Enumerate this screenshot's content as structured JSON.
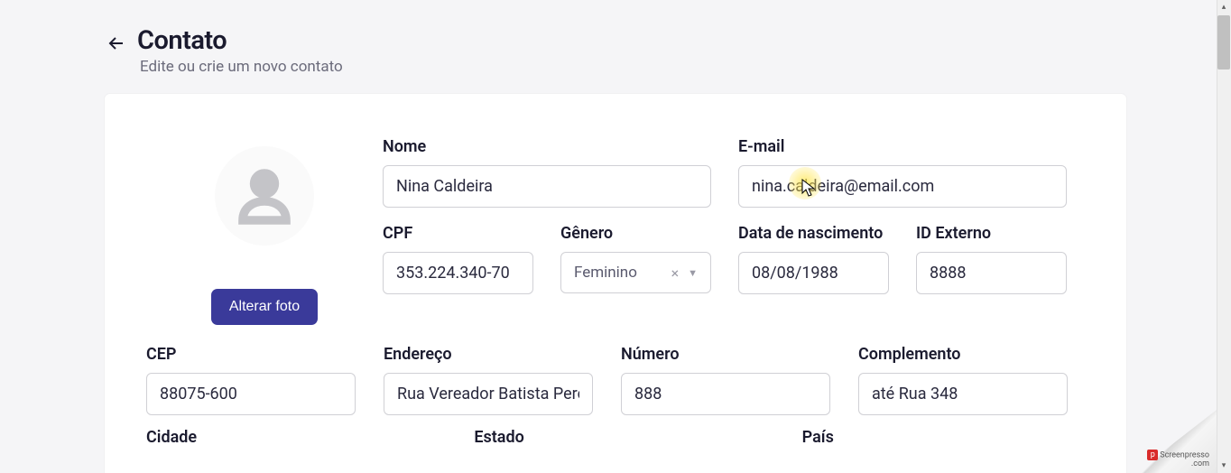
{
  "header": {
    "title": "Contato",
    "subtitle": "Edite ou crie um novo contato"
  },
  "avatar": {
    "change_photo_label": "Alterar foto"
  },
  "fields": {
    "nome": {
      "label": "Nome",
      "value": "Nina Caldeira"
    },
    "email": {
      "label": "E-mail",
      "value": "nina.caldeira@email.com"
    },
    "cpf": {
      "label": "CPF",
      "value": "353.224.340-70"
    },
    "genero": {
      "label": "Gênero",
      "value": "Feminino"
    },
    "data_nascimento": {
      "label": "Data de nascimento",
      "value": "08/08/1988"
    },
    "id_externo": {
      "label": "ID Externo",
      "value": "8888"
    },
    "cep": {
      "label": "CEP",
      "value": "88075-600"
    },
    "endereco": {
      "label": "Endereço",
      "value": "Rua Vereador Batista Pere"
    },
    "numero": {
      "label": "Número",
      "value": "888"
    },
    "complemento": {
      "label": "Complemento",
      "value": "até Rua 348"
    },
    "cidade": {
      "label": "Cidade"
    },
    "estado": {
      "label": "Estado"
    },
    "pais": {
      "label": "País"
    }
  },
  "watermark": {
    "brand": "Screenpresso",
    "domain": ".com"
  }
}
